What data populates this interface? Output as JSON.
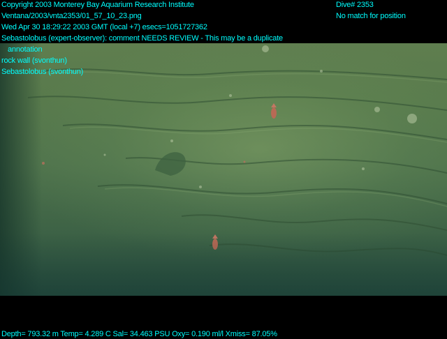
{
  "overlay": {
    "copyright": "Copyright 2003 Monterey Bay Aquarium Research Institute",
    "filepath": "Ventana/2003/vnta2353/01_57_10_23.png",
    "datetime": "Wed Apr 30 18:29:22 2003 GMT (local +7)  esecs=1051727362",
    "annotation_1_line1": "Sebastolobus (expert-observer): comment NEEDS REVIEW - This may be a duplicate",
    "annotation_1_line2": "annotation",
    "annotation_2": "rock wall (svonthun)",
    "annotation_3": "Sebastolobus (svonthun)",
    "dive": "Dive# 2353",
    "position_status": "No match for position",
    "telemetry": "Depth= 793.32 m  Temp= 4.289 C  Sal= 34.463 PSU  Oxy= 0.190 ml/l  Xmiss= 87.05%"
  },
  "colors": {
    "overlay_text": "#00ffff",
    "background": "#000000",
    "seafloor": "#4f734c"
  },
  "scene": {
    "subjects": [
      "rock-wall",
      "sebastolobus-fish"
    ]
  }
}
